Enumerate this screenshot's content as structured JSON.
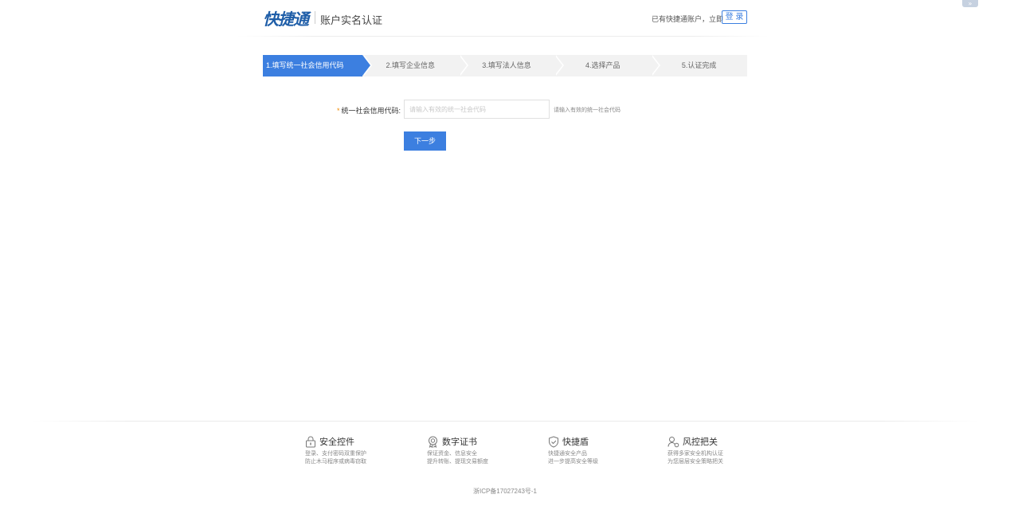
{
  "header": {
    "logo": "快捷通",
    "title": "账户实名认证",
    "account_hint": "已有快捷通账户，立即",
    "login_label": "登 录",
    "corner_toggle_icon": "double-chevron-right-icon"
  },
  "steps": [
    {
      "label": "1.填写统一社会信用代码",
      "active": true
    },
    {
      "label": "2.填写企业信息",
      "active": false
    },
    {
      "label": "3.填写法人信息",
      "active": false
    },
    {
      "label": "4.选择产品",
      "active": false
    },
    {
      "label": "5.认证完成",
      "active": false
    }
  ],
  "form": {
    "required_mark": "*",
    "label": "统一社会信用代码:",
    "input_value": "",
    "input_placeholder": "请输入有效的统一社会代码",
    "input_hint": "请输入有效的统一社会代码",
    "next_label": "下一步"
  },
  "features": [
    {
      "icon": "lock-icon",
      "title": "安全控件",
      "desc": [
        "登录、支付密码双重保护",
        "防止木马程序或病毒窃取"
      ]
    },
    {
      "icon": "certificate-icon",
      "title": "数字证书",
      "desc": [
        "保证资金、信息安全",
        "提升转账、提现交易额度"
      ]
    },
    {
      "icon": "shield-check-icon",
      "title": "快捷盾",
      "desc": [
        "快捷通安全产品",
        "进一步提高安全等级"
      ]
    },
    {
      "icon": "user-risk-icon",
      "title": "风控把关",
      "desc": [
        "获得多家安全机构认证",
        "为您层层安全策略把关"
      ]
    }
  ],
  "footer": {
    "icp": "浙ICP备17027243号-1"
  },
  "colors": {
    "accent": "#3c7fe0",
    "logo": "#1f5ea8",
    "step_inactive": "#f2f2f2",
    "required": "#f08a00"
  }
}
